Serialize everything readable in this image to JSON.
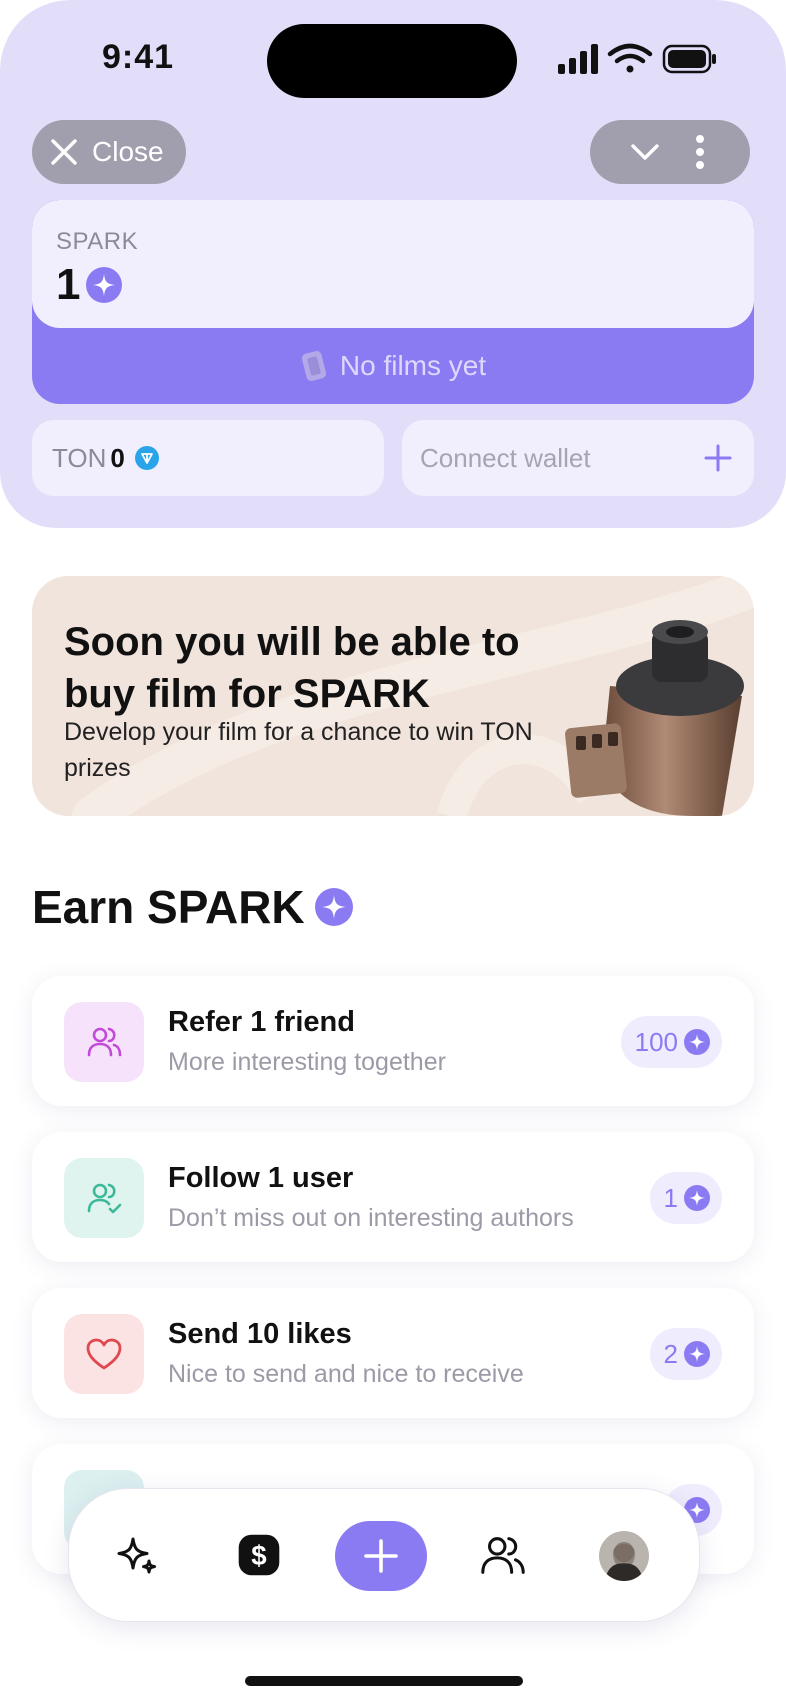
{
  "status_bar": {
    "time": "9:41"
  },
  "header": {
    "close_label": "Close",
    "spark_label": "SPARK",
    "spark_value": "1",
    "no_films_label": "No films yet",
    "ton_label": "TON",
    "ton_value": "0",
    "connect_wallet_label": "Connect wallet"
  },
  "banner": {
    "title": "Soon you will be able to buy film for SPARK",
    "subtitle": "Develop your film for a chance to win TON prizes"
  },
  "earn": {
    "title": "Earn SPARK",
    "tasks": [
      {
        "title": "Refer 1 friend",
        "subtitle": "More interesting together",
        "reward": "100",
        "icon": "users-icon",
        "icon_bg": "#f6e3fb",
        "icon_color": "#c34ad9"
      },
      {
        "title": "Follow 1 user",
        "subtitle": "Don’t miss out on interesting authors",
        "reward": "1",
        "icon": "user-check-icon",
        "icon_bg": "#dff4ee",
        "icon_color": "#3cb99a"
      },
      {
        "title": "Send 10 likes",
        "subtitle": "Nice to send and nice to receive",
        "reward": "2",
        "icon": "heart-icon",
        "icon_bg": "#fbe3e3",
        "icon_color": "#e0474f"
      }
    ]
  },
  "colors": {
    "accent": "#8b7bf3",
    "header_bg": "#e2defa",
    "card_bg": "#f1effd",
    "banner_bg": "#f1e4dc"
  },
  "nav": {
    "items": [
      "sparkles-icon",
      "dollar-icon",
      "add-button",
      "people-icon",
      "avatar"
    ]
  }
}
